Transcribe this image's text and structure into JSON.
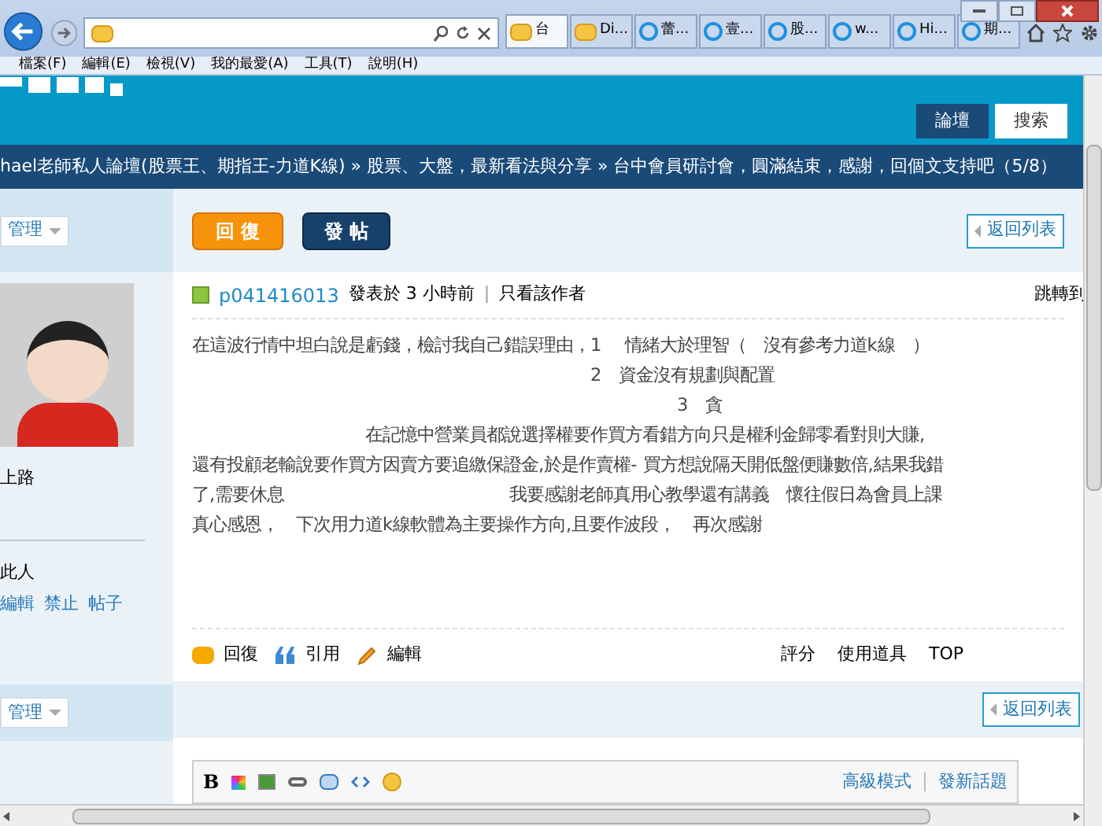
{
  "browser": {
    "tabs": [
      {
        "label": "台",
        "selected": true,
        "kind": "forum"
      },
      {
        "label": "Di...",
        "selected": false,
        "kind": "forum"
      },
      {
        "label": "蕾...",
        "selected": false,
        "kind": "ie"
      },
      {
        "label": "壹...",
        "selected": false,
        "kind": "ie"
      },
      {
        "label": "股...",
        "selected": false,
        "kind": "ie"
      },
      {
        "label": "w...",
        "selected": false,
        "kind": "ie"
      },
      {
        "label": "Hi...",
        "selected": false,
        "kind": "ie"
      },
      {
        "label": "期...",
        "selected": false,
        "kind": "ie"
      }
    ],
    "menu": [
      "檔案(F)",
      "編輯(E)",
      "檢視(V)",
      "我的最愛(A)",
      "工具(T)",
      "說明(H)"
    ]
  },
  "header": {
    "nav": [
      {
        "label": "論壇",
        "selected": true
      },
      {
        "label": "搜索",
        "selected": false
      }
    ]
  },
  "breadcrumb": "hael老師私人論壇(股票王、期指王-力道K線) » 股票、大盤，最新看法與分享 » 台中會員研討會，圓滿結束，感謝，回個文支持吧（5/8）",
  "toolbar": {
    "manage": "管理",
    "reply": "回 復",
    "post": "發 帖",
    "back": "返回列表"
  },
  "sidebar": {
    "rank": "上路",
    "watch": "此人",
    "links": [
      "編輯",
      "禁止",
      "帖子"
    ]
  },
  "post": {
    "author": "p041416013",
    "time": "發表於 3 小時前",
    "separator": "|",
    "filter": "只看該作者",
    "jump": "跳轉到",
    "lines": [
      "在這波行情中坦白說是虧錢，檢討我自己錯誤理由，1　 情緒大於理智（　沒有參考力道k線　）",
      "　　　　　　　　　　　　　　　　　　　　　　　2　資金沒有規劃與配置",
      "　　　　　　　　　　　　　　　　　　　　　　　　　　　　3　貪",
      "　　　　　　　　　　在記憶中營業員都說選擇權要作買方看錯方向只是權利金歸零看對則大賺,",
      "還有投顧老輸說要作買方因賣方要追繳保證金,於是作賣權- 買方想說隔天開低盤便賺數倍,結果我錯",
      "了,需要休息　　　　　　　　　　　　　我要感謝老師真用心教學還有講義　懷往假日為會員上課",
      "真心感恩，　下次用力道k線軟體為主要操作方向,且要作波段，　再次感謝"
    ],
    "actions": [
      {
        "label": "回復",
        "kind": "reply"
      },
      {
        "label": "引用",
        "kind": "quote"
      },
      {
        "label": "編輯",
        "kind": "edit"
      }
    ],
    "right_actions": [
      "評分",
      "使用道具",
      "TOP"
    ]
  },
  "toolbar2": {
    "manage": "管理",
    "back": "返回列表"
  },
  "editor": {
    "bold": "B",
    "links": [
      "高級模式",
      "發新話題"
    ]
  }
}
